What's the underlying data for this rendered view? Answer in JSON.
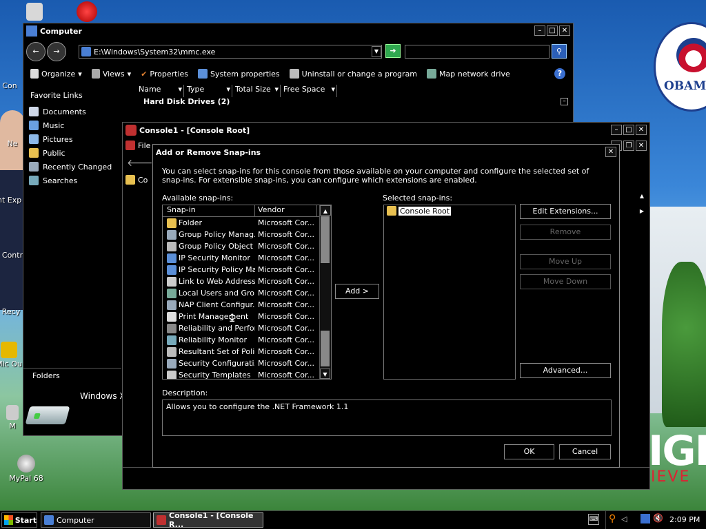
{
  "desktop": {
    "icons": [
      {
        "label": "Con"
      },
      {
        "label": "Ne"
      },
      {
        "label": "Int Exp"
      },
      {
        "label": "Contr"
      },
      {
        "label": "Recy"
      },
      {
        "label": "Mic Ou"
      },
      {
        "label": "M"
      },
      {
        "label": "MyPal 68"
      }
    ],
    "wallpaper_logo_text": "OBAM",
    "wallpaper_change_text": "IGE",
    "wallpaper_believe_text": "IEVE"
  },
  "explorer": {
    "title": "Computer",
    "address": "E:\\Windows\\System32\\mmc.exe",
    "toolbar": {
      "organize": "Organize",
      "views": "Views",
      "properties": "Properties",
      "system_properties": "System properties",
      "uninstall": "Uninstall or change a program",
      "map_drive": "Map network drive"
    },
    "favorite_links_title": "Favorite Links",
    "favorite_links": [
      "Documents",
      "Music",
      "Pictures",
      "Public",
      "Recently Changed",
      "Searches"
    ],
    "columns": [
      "Name",
      "Type",
      "Total Size",
      "Free Space"
    ],
    "group_header": "Hard Disk Drives (2)",
    "folders_label": "Folders",
    "bottom_item": "Windows X"
  },
  "mmc": {
    "title": "Console1 - [Console Root]",
    "menu_first": "File",
    "tree_item": "Co"
  },
  "dialog": {
    "title": "Add or Remove Snap-ins",
    "description_text": "You can select snap-ins for this console from those available on your computer and configure the selected set of snap-ins. For extensible snap-ins, you can configure which extensions are enabled.",
    "available_label": "Available snap-ins:",
    "selected_label": "Selected snap-ins:",
    "col_snapin": "Snap-in",
    "col_vendor": "Vendor",
    "available": [
      {
        "name": "Folder",
        "vendor": "Microsoft Cor..."
      },
      {
        "name": "Group Policy Manag...",
        "vendor": "Microsoft Cor..."
      },
      {
        "name": "Group Policy Object ...",
        "vendor": "Microsoft Cor..."
      },
      {
        "name": "IP Security Monitor",
        "vendor": "Microsoft Cor..."
      },
      {
        "name": "IP Security Policy Ma...",
        "vendor": "Microsoft Cor..."
      },
      {
        "name": "Link to Web Address",
        "vendor": "Microsoft Cor..."
      },
      {
        "name": "Local Users and Gro...",
        "vendor": "Microsoft Cor..."
      },
      {
        "name": "NAP Client Configur...",
        "vendor": "Microsoft Cor..."
      },
      {
        "name": "Print Management",
        "vendor": "Microsoft Cor..."
      },
      {
        "name": "Reliability and Perfor...",
        "vendor": "Microsoft Cor..."
      },
      {
        "name": "Reliability Monitor",
        "vendor": "Microsoft Cor..."
      },
      {
        "name": "Resultant Set of Policy",
        "vendor": "Microsoft Cor..."
      },
      {
        "name": "Security Configurati...",
        "vendor": "Microsoft Cor..."
      },
      {
        "name": "Security Templates",
        "vendor": "Microsoft Cor..."
      }
    ],
    "selected": [
      "Console Root"
    ],
    "add_button": "Add >",
    "edit_extensions_button": "Edit Extensions...",
    "remove_button": "Remove",
    "move_up_button": "Move Up",
    "move_down_button": "Move Down",
    "advanced_button": "Advanced...",
    "description_label": "Description:",
    "description_value": "Allows you to configure the .NET Framework 1.1",
    "ok_button": "OK",
    "cancel_button": "Cancel"
  },
  "taskbar": {
    "start": "Start",
    "tasks": [
      "Computer",
      "Console1 - [Console R..."
    ],
    "clock": "2:09 PM"
  },
  "colors": {
    "window_bg": "#000000",
    "taskbar_bg": "#000000",
    "accent_green": "#2fa84f",
    "selection": "#ffffff"
  }
}
